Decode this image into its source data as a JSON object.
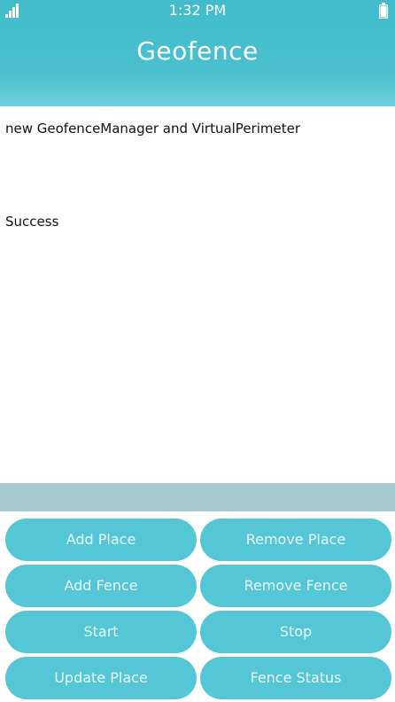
{
  "status_bar": {
    "time": "1:32 PM"
  },
  "title": "Geofence",
  "messages": [
    "new GeofenceManager and VirtualPerimeter",
    "Success"
  ],
  "buttons": {
    "add_place": "Add Place",
    "remove_place": "Remove Place",
    "add_fence": "Add Fence",
    "remove_fence": "Remove Fence",
    "start": "Start",
    "stop": "Stop",
    "update_place": "Update Place",
    "fence_status": "Fence Status"
  },
  "colors": {
    "header": "#42bccb",
    "band": "#a7c7d1",
    "button": "#54c6d6"
  }
}
